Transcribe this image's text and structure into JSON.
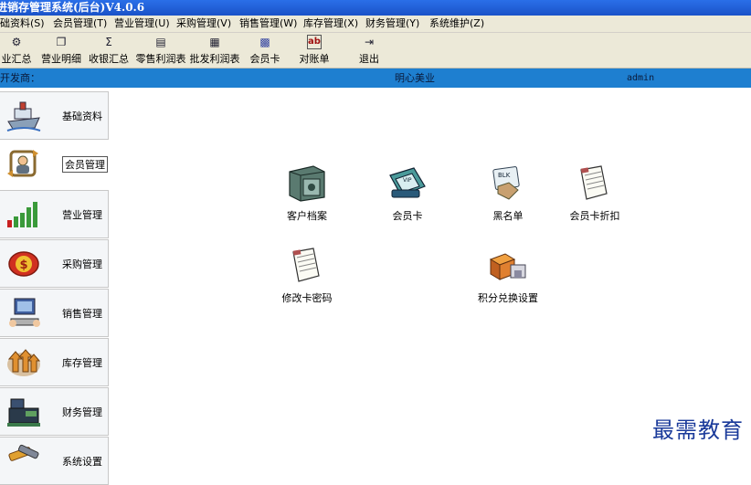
{
  "window": {
    "title": "进销存管理系统(后台)V4.0.6"
  },
  "menubar": [
    "础资料(S)",
    "会员管理(T)",
    "营业管理(U)",
    "采购管理(V)",
    "销售管理(W)",
    "库存管理(X)",
    "财务管理(Y)",
    "系统维护(Z)"
  ],
  "toolbar": [
    {
      "label": "业汇总",
      "icon": "gear-icon",
      "glyph": "⚙"
    },
    {
      "label": "营业明细",
      "icon": "windows-icon",
      "glyph": "❐"
    },
    {
      "label": "收银汇总",
      "icon": "sigma-icon",
      "glyph": "Σ"
    },
    {
      "label": "零售利润表",
      "icon": "report-icon",
      "glyph": "▤"
    },
    {
      "label": "批发利润表",
      "icon": "grid-icon",
      "glyph": "▦"
    },
    {
      "label": "会员卡",
      "icon": "card-icon",
      "glyph": "▩"
    },
    {
      "label": "对账单",
      "icon": "ledger-icon",
      "glyph": "ab"
    },
    {
      "label": "退出",
      "icon": "exit-icon",
      "glyph": "⇥"
    }
  ],
  "statusbar": {
    "developer_label": "开发商：",
    "company": "明心美业",
    "user": "admin"
  },
  "sidebar": [
    {
      "label": "基础资料",
      "icon": "ship-icon"
    },
    {
      "label": "会员管理",
      "icon": "member-cycle-icon"
    },
    {
      "label": "营业管理",
      "icon": "bar-chart-icon"
    },
    {
      "label": "采购管理",
      "icon": "dollar-coin-icon"
    },
    {
      "label": "销售管理",
      "icon": "computer-icon"
    },
    {
      "label": "库存管理",
      "icon": "stock-arrows-icon"
    },
    {
      "label": "财务管理",
      "icon": "cash-register-icon"
    },
    {
      "label": "系统设置",
      "icon": "tools-icon"
    }
  ],
  "main": {
    "items": [
      {
        "label": "客户档案",
        "icon": "safe-icon"
      },
      {
        "label": "会员卡",
        "icon": "member-card-icon"
      },
      {
        "label": "黑名单",
        "icon": "blacklist-icon"
      },
      {
        "label": "会员卡折扣",
        "icon": "discount-doc-icon"
      },
      {
        "label": "修改卡密码",
        "icon": "password-doc-icon"
      },
      {
        "label": "积分兑换设置",
        "icon": "gift-boxes-icon"
      }
    ]
  },
  "watermark": "最需教育",
  "colors": {
    "titlebar": "#1a52c8",
    "statusbar": "#1e7fd0",
    "chrome": "#ece9d8",
    "watermark": "#1a3a9a"
  }
}
